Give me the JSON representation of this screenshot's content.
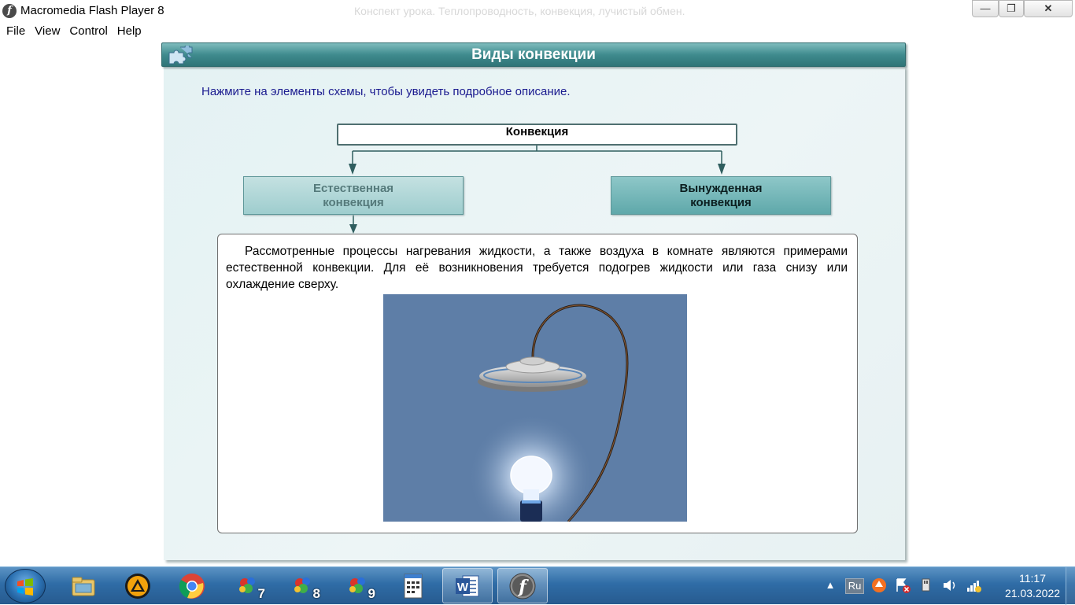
{
  "window": {
    "title": "Macromedia Flash Player 8",
    "background_title": "Конспект урока. Теплопроводность, конвекция, лучистый обмен.",
    "minimize_glyph": "—",
    "maximize_glyph": "❐",
    "close_glyph": "✕"
  },
  "menu": [
    "File",
    "View",
    "Control",
    "Help"
  ],
  "lesson": {
    "title": "Виды конвекции",
    "instruction": "Нажмите на элементы схемы, чтобы увидеть подробное описание.",
    "root_node": "Конвекция",
    "branches": [
      {
        "label_line1": "Естественная",
        "label_line2": "конвекция",
        "state": "selected"
      },
      {
        "label_line1": "Вынужденная",
        "label_line2": "конвекция",
        "state": "normal"
      }
    ],
    "description": "Рассмотренные процессы нагревания жидкости, а также воздуха в комнате являются примерами естественной конвекции. Для её возникновения требуется подогрев жидкости или газа снизу или охлаждение сверху."
  },
  "taskbar": {
    "items": [
      {
        "name": "explorer-icon",
        "active": false
      },
      {
        "name": "aimp-icon",
        "active": false
      },
      {
        "name": "chrome-icon",
        "active": false
      },
      {
        "name": "chemistry-7-icon",
        "label": "7",
        "active": false
      },
      {
        "name": "chemistry-8-icon",
        "label": "8",
        "active": false
      },
      {
        "name": "chemistry-9-icon",
        "label": "9",
        "active": false
      },
      {
        "name": "notepad-icon",
        "active": false
      },
      {
        "name": "word-icon",
        "active": true
      },
      {
        "name": "flash-player-icon",
        "active": true
      }
    ],
    "tray": {
      "language": "Ru",
      "time": "11:17",
      "date": "21.03.2022"
    }
  },
  "colors": {
    "header_teal": "#3f8b8e",
    "panel_bg": "#e4f2f3",
    "instruction_text": "#1a1a8f",
    "selected_branch": "#9ecdce",
    "normal_branch": "#5fa8aa",
    "figure_bg": "#5e7ea7",
    "taskbar": "#2f6ca6"
  }
}
